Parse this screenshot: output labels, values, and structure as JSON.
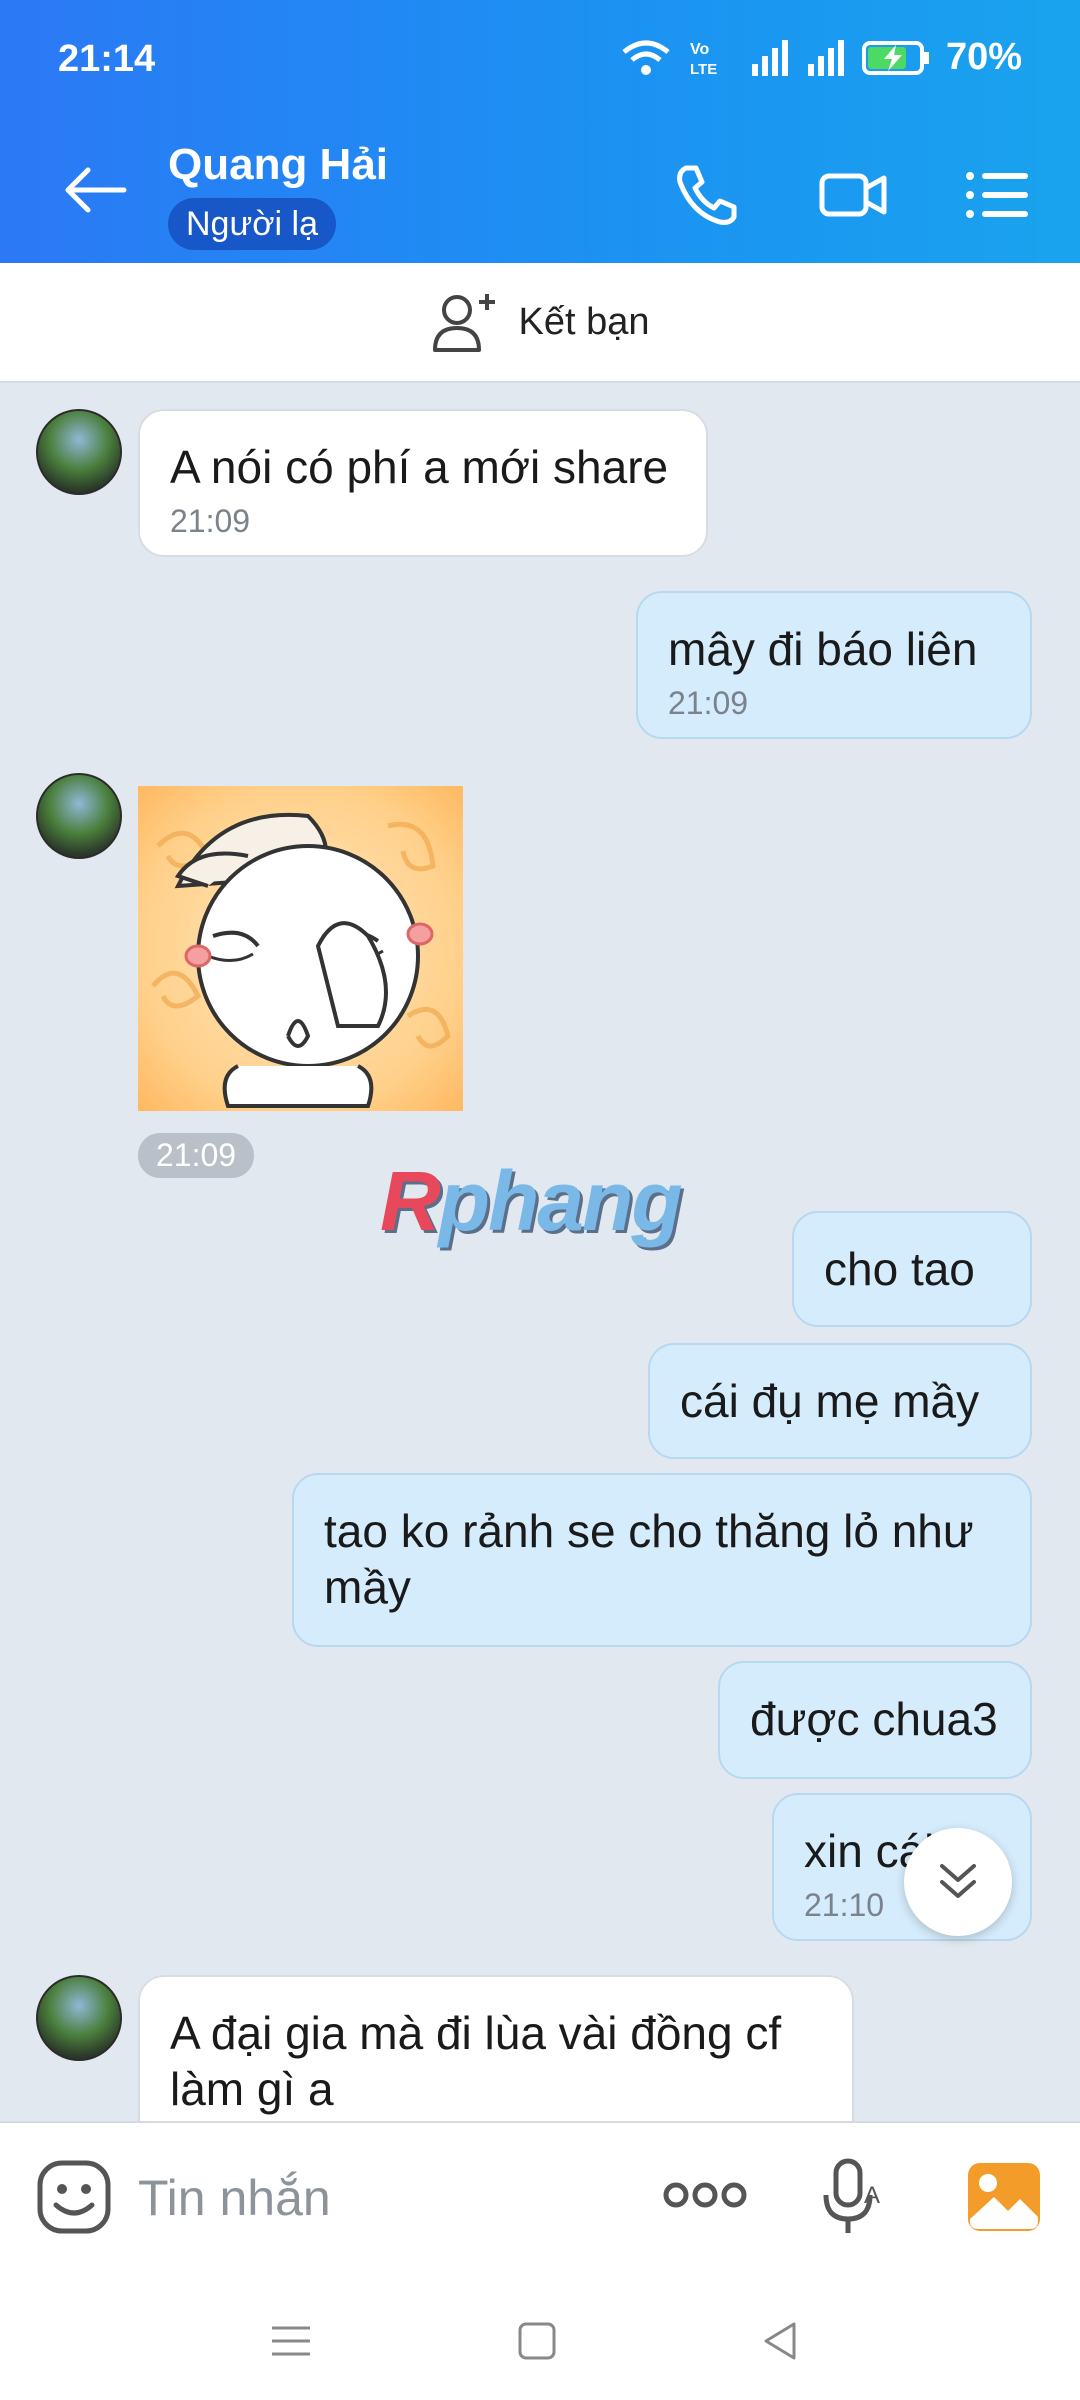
{
  "status_bar": {
    "time": "21:14",
    "battery": "70%",
    "icons": [
      "wifi-icon",
      "volte-icon",
      "signal-icon",
      "signal-icon",
      "battery-charging-icon"
    ]
  },
  "header": {
    "contact_name": "Quang Hải",
    "badge": "Người lạ",
    "icons": [
      "back-arrow-icon",
      "phone-icon",
      "video-call-icon",
      "menu-list-icon"
    ]
  },
  "add_friend": {
    "label": "Kết bạn",
    "icon": "add-user-icon"
  },
  "messages": [
    {
      "dir": "in",
      "text": "A nói có phí a mới share",
      "time": "21:09"
    },
    {
      "dir": "out",
      "text": "mây đi báo liên",
      "time": "21:09"
    },
    {
      "dir": "in",
      "type": "sticker",
      "time": "21:09"
    },
    {
      "dir": "out",
      "text": "cho tao"
    },
    {
      "dir": "out",
      "text": "cái đụ mẹ mầy"
    },
    {
      "dir": "out",
      "text": "tao ko rảnh se cho thăng lỏ như mầy"
    },
    {
      "dir": "out",
      "text": "được chua3"
    },
    {
      "dir": "out",
      "text": "xin cái",
      "time": "21:10"
    },
    {
      "dir": "in",
      "text": "A đại gia mà đi lùa vài đồng cf làm gì a"
    }
  ],
  "watermark": {
    "first": "R",
    "rest": "phang"
  },
  "input": {
    "placeholder": "Tin nhắn"
  },
  "colors": {
    "header_start": "#2b79f5",
    "header_end": "#19a3ee",
    "out_bubble": "#d5ecfc",
    "chat_bg": "#e2e8ef"
  }
}
